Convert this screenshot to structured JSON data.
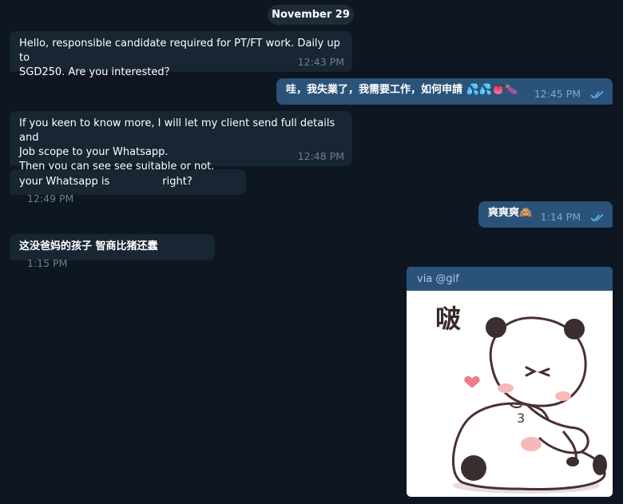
{
  "date_label": "November 29",
  "messages": [
    {
      "dir": "in",
      "text": "Hello, responsible candidate required for PT/FT work. Daily up to\nSGD250. Are you interested？",
      "time": "12:43 PM"
    },
    {
      "dir": "out",
      "text": "哇，我失業了，我需要工作，如何申請 💦💦👅🍆",
      "time": "12:45 PM",
      "status": "read"
    },
    {
      "dir": "in",
      "text": "If you keen to know more, I will let my client send full details and\nJob scope to your Whatsapp.\nThen you can see see suitable or not.",
      "time": "12:48 PM"
    },
    {
      "dir": "in",
      "text_before": "your Whatsapp is",
      "text_after": "right?",
      "time": "12:49 PM"
    },
    {
      "dir": "out",
      "text": "爽爽爽🙈",
      "time": "1:14 PM",
      "status": "read"
    },
    {
      "dir": "in",
      "text": "这没爸妈的孩子 智商比猪还蠢",
      "time": "1:15 PM"
    }
  ],
  "gif": {
    "via_label": "via @gif",
    "sticker_text": "啵"
  },
  "colors": {
    "chat_background": "#0e1621",
    "incoming_bubble": "#182533",
    "outgoing_bubble": "#2b5278",
    "read_ticks": "#5fb4f5"
  }
}
